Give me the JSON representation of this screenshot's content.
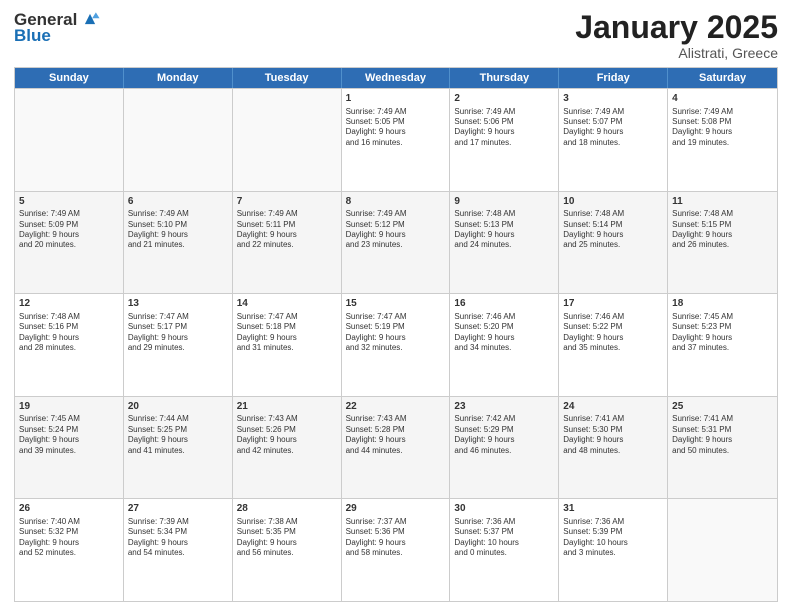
{
  "logo": {
    "general": "General",
    "blue": "Blue"
  },
  "header": {
    "month": "January 2025",
    "location": "Alistrati, Greece"
  },
  "weekdays": [
    "Sunday",
    "Monday",
    "Tuesday",
    "Wednesday",
    "Thursday",
    "Friday",
    "Saturday"
  ],
  "weeks": [
    [
      {
        "day": "",
        "text": ""
      },
      {
        "day": "",
        "text": ""
      },
      {
        "day": "",
        "text": ""
      },
      {
        "day": "1",
        "text": "Sunrise: 7:49 AM\nSunset: 5:05 PM\nDaylight: 9 hours\nand 16 minutes."
      },
      {
        "day": "2",
        "text": "Sunrise: 7:49 AM\nSunset: 5:06 PM\nDaylight: 9 hours\nand 17 minutes."
      },
      {
        "day": "3",
        "text": "Sunrise: 7:49 AM\nSunset: 5:07 PM\nDaylight: 9 hours\nand 18 minutes."
      },
      {
        "day": "4",
        "text": "Sunrise: 7:49 AM\nSunset: 5:08 PM\nDaylight: 9 hours\nand 19 minutes."
      }
    ],
    [
      {
        "day": "5",
        "text": "Sunrise: 7:49 AM\nSunset: 5:09 PM\nDaylight: 9 hours\nand 20 minutes."
      },
      {
        "day": "6",
        "text": "Sunrise: 7:49 AM\nSunset: 5:10 PM\nDaylight: 9 hours\nand 21 minutes."
      },
      {
        "day": "7",
        "text": "Sunrise: 7:49 AM\nSunset: 5:11 PM\nDaylight: 9 hours\nand 22 minutes."
      },
      {
        "day": "8",
        "text": "Sunrise: 7:49 AM\nSunset: 5:12 PM\nDaylight: 9 hours\nand 23 minutes."
      },
      {
        "day": "9",
        "text": "Sunrise: 7:48 AM\nSunset: 5:13 PM\nDaylight: 9 hours\nand 24 minutes."
      },
      {
        "day": "10",
        "text": "Sunrise: 7:48 AM\nSunset: 5:14 PM\nDaylight: 9 hours\nand 25 minutes."
      },
      {
        "day": "11",
        "text": "Sunrise: 7:48 AM\nSunset: 5:15 PM\nDaylight: 9 hours\nand 26 minutes."
      }
    ],
    [
      {
        "day": "12",
        "text": "Sunrise: 7:48 AM\nSunset: 5:16 PM\nDaylight: 9 hours\nand 28 minutes."
      },
      {
        "day": "13",
        "text": "Sunrise: 7:47 AM\nSunset: 5:17 PM\nDaylight: 9 hours\nand 29 minutes."
      },
      {
        "day": "14",
        "text": "Sunrise: 7:47 AM\nSunset: 5:18 PM\nDaylight: 9 hours\nand 31 minutes."
      },
      {
        "day": "15",
        "text": "Sunrise: 7:47 AM\nSunset: 5:19 PM\nDaylight: 9 hours\nand 32 minutes."
      },
      {
        "day": "16",
        "text": "Sunrise: 7:46 AM\nSunset: 5:20 PM\nDaylight: 9 hours\nand 34 minutes."
      },
      {
        "day": "17",
        "text": "Sunrise: 7:46 AM\nSunset: 5:22 PM\nDaylight: 9 hours\nand 35 minutes."
      },
      {
        "day": "18",
        "text": "Sunrise: 7:45 AM\nSunset: 5:23 PM\nDaylight: 9 hours\nand 37 minutes."
      }
    ],
    [
      {
        "day": "19",
        "text": "Sunrise: 7:45 AM\nSunset: 5:24 PM\nDaylight: 9 hours\nand 39 minutes."
      },
      {
        "day": "20",
        "text": "Sunrise: 7:44 AM\nSunset: 5:25 PM\nDaylight: 9 hours\nand 41 minutes."
      },
      {
        "day": "21",
        "text": "Sunrise: 7:43 AM\nSunset: 5:26 PM\nDaylight: 9 hours\nand 42 minutes."
      },
      {
        "day": "22",
        "text": "Sunrise: 7:43 AM\nSunset: 5:28 PM\nDaylight: 9 hours\nand 44 minutes."
      },
      {
        "day": "23",
        "text": "Sunrise: 7:42 AM\nSunset: 5:29 PM\nDaylight: 9 hours\nand 46 minutes."
      },
      {
        "day": "24",
        "text": "Sunrise: 7:41 AM\nSunset: 5:30 PM\nDaylight: 9 hours\nand 48 minutes."
      },
      {
        "day": "25",
        "text": "Sunrise: 7:41 AM\nSunset: 5:31 PM\nDaylight: 9 hours\nand 50 minutes."
      }
    ],
    [
      {
        "day": "26",
        "text": "Sunrise: 7:40 AM\nSunset: 5:32 PM\nDaylight: 9 hours\nand 52 minutes."
      },
      {
        "day": "27",
        "text": "Sunrise: 7:39 AM\nSunset: 5:34 PM\nDaylight: 9 hours\nand 54 minutes."
      },
      {
        "day": "28",
        "text": "Sunrise: 7:38 AM\nSunset: 5:35 PM\nDaylight: 9 hours\nand 56 minutes."
      },
      {
        "day": "29",
        "text": "Sunrise: 7:37 AM\nSunset: 5:36 PM\nDaylight: 9 hours\nand 58 minutes."
      },
      {
        "day": "30",
        "text": "Sunrise: 7:36 AM\nSunset: 5:37 PM\nDaylight: 10 hours\nand 0 minutes."
      },
      {
        "day": "31",
        "text": "Sunrise: 7:36 AM\nSunset: 5:39 PM\nDaylight: 10 hours\nand 3 minutes."
      },
      {
        "day": "",
        "text": ""
      }
    ]
  ]
}
